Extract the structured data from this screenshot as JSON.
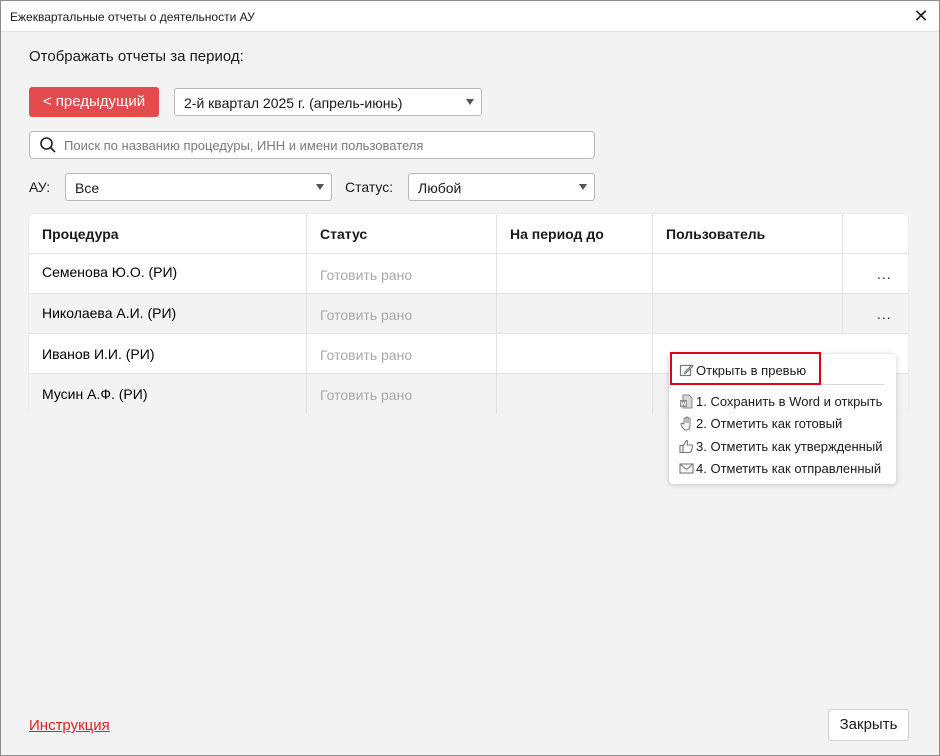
{
  "window": {
    "title": "Ежеквартальные отчеты о деятельности АУ",
    "close_glyph": "✕"
  },
  "period": {
    "label": "Отображать отчеты за период:",
    "prev_button": "< предыдущий",
    "selected": "2-й квартал 2025 г. (апрель-июнь)"
  },
  "search": {
    "placeholder": "Поиск по названию процедуры, ИНН и имени пользователя"
  },
  "filters": {
    "au_label": "АУ:",
    "au_value": "Все",
    "status_label": "Статус:",
    "status_value": "Любой"
  },
  "table": {
    "headers": [
      "Процедура",
      "Статус",
      "На период до",
      "Пользователь",
      ""
    ],
    "rows": [
      {
        "procedure": "Семенова Ю.О. (РИ)",
        "status": "Готовить рано",
        "period": "",
        "user": "",
        "actions": "..."
      },
      {
        "procedure": "Николаева А.И. (РИ)",
        "status": "Готовить рано",
        "period": "",
        "user": "",
        "actions": "..."
      },
      {
        "procedure": "Иванов И.И. (РИ)",
        "status": "Готовить рано",
        "period": "",
        "user": "",
        "actions": ""
      },
      {
        "procedure": "Мусин А.Ф. (РИ)",
        "status": "Готовить рано",
        "period": "",
        "user": "",
        "actions": ""
      }
    ]
  },
  "context_menu": {
    "items": [
      {
        "label": "Открыть в превью",
        "icon": "edit-icon"
      },
      {
        "label": "1. Сохранить в Word и открыть",
        "icon": "word-icon"
      },
      {
        "label": "2. Отметить как готовый",
        "icon": "hand-icon"
      },
      {
        "label": "3. Отметить как утвержденный",
        "icon": "thumbs-up-icon"
      },
      {
        "label": "4. Отметить как отправленный",
        "icon": "envelope-icon"
      }
    ]
  },
  "footer": {
    "instruction_link": "Инструкция",
    "close_button": "Закрыть"
  },
  "colors": {
    "accent": "#e24c4f",
    "highlight": "#e0001a",
    "link": "#e02020"
  }
}
